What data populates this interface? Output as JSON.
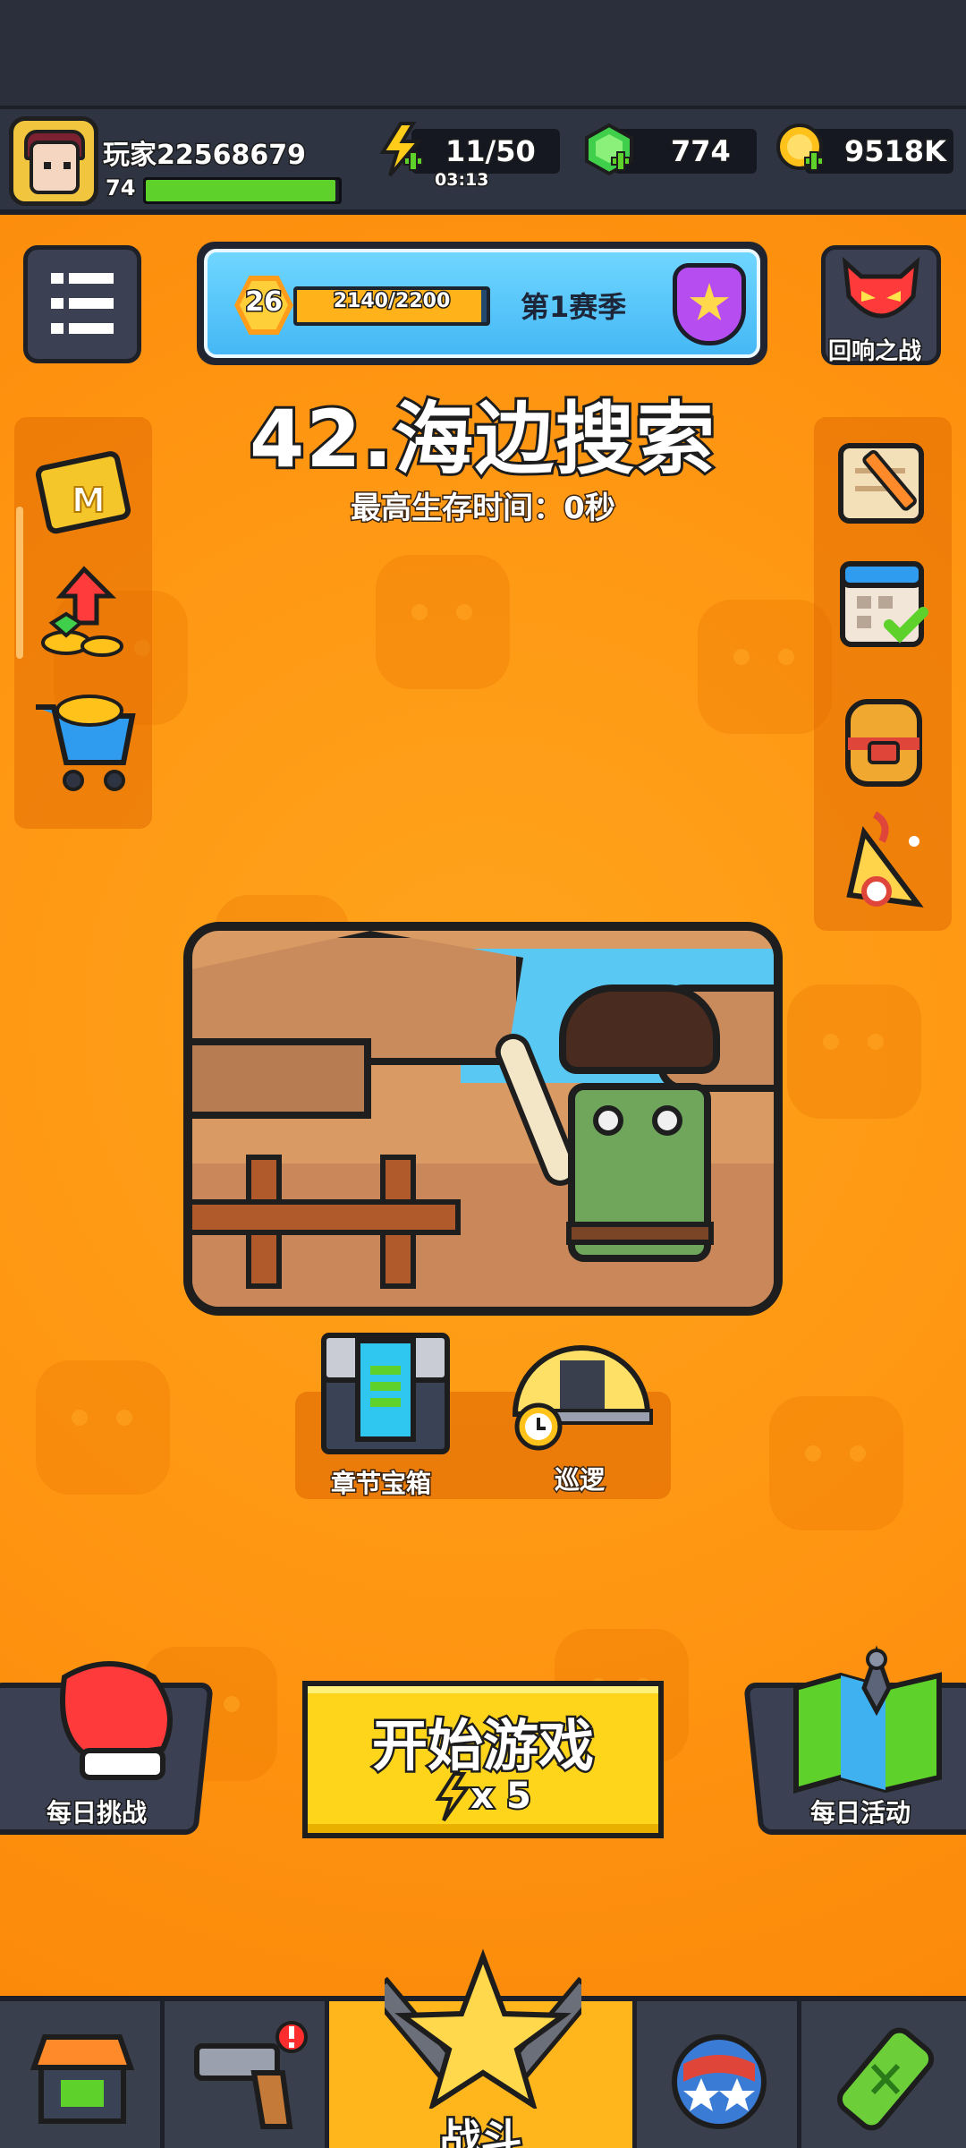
{
  "player": {
    "name": "玩家22568679",
    "level": "74",
    "xp_progress": 0.98
  },
  "resources": {
    "energy": "11/50",
    "energy_timer": "03:13",
    "gems": "774",
    "gold": "9518K"
  },
  "season": {
    "level": "26",
    "progress_text": "2140/2200",
    "progress": 0.973,
    "title": "第1赛季"
  },
  "top_right_button": {
    "label": "回响之战"
  },
  "stage": {
    "title": "42.海边搜索",
    "subtitle": "最高生存时间：0秒"
  },
  "stage_actions": {
    "chest_label": "章节宝箱",
    "patrol_label": "巡逻"
  },
  "bottom_actions": {
    "daily_challenge": "每日挑战",
    "start_title": "开始游戏",
    "start_cost": "x 5",
    "daily_event": "每日活动"
  },
  "navbar": {
    "battle": "战斗"
  },
  "left_panel": [
    "month-card-icon",
    "growth-fund-icon",
    "shop-cart-icon"
  ],
  "right_panel": [
    "scroll-quest-icon",
    "calendar-checkin-icon",
    "backpack-icon",
    "party-event-icon"
  ],
  "colors": {
    "accent_orange": "#ff9612",
    "button_yellow": "#ffd51c",
    "panel_dark": "#3b4152",
    "season_blue": "#45b8f5",
    "xp_green": "#5fd12b"
  }
}
